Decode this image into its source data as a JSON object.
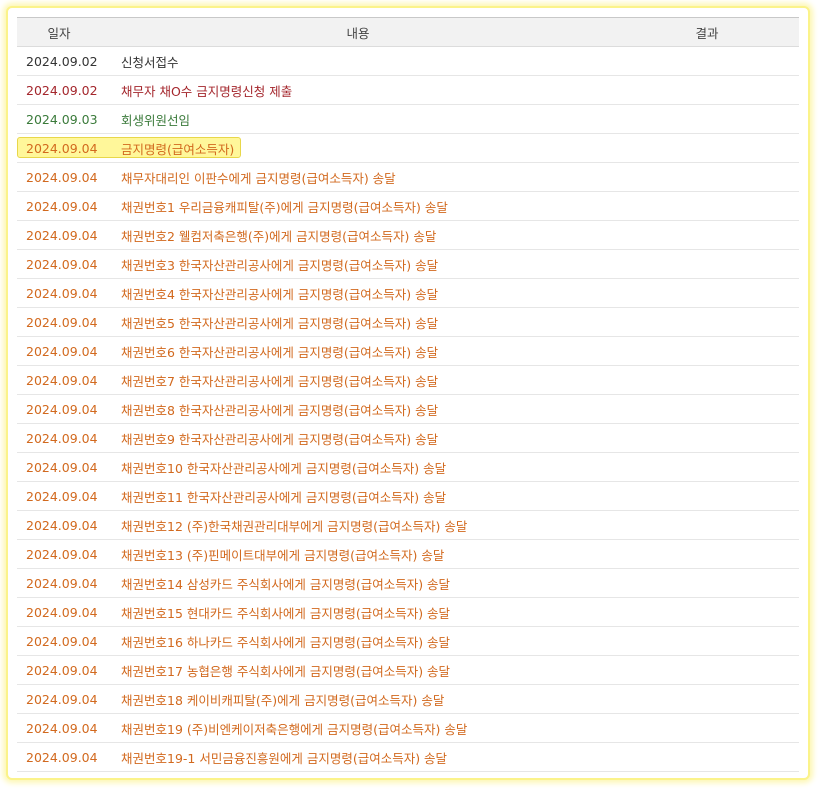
{
  "headers": {
    "date": "일자",
    "content": "내용",
    "result": "결과"
  },
  "colors": {
    "black": "#333333",
    "red": "#a4262c",
    "green": "#3a7a3a",
    "orange": "#d2691e",
    "highlight": "#fff79a"
  },
  "rows": [
    {
      "date": "2024.09.02",
      "content": "신청서접수",
      "result": "",
      "color": "black"
    },
    {
      "date": "2024.09.02",
      "content": "채무자 채O수 금지명령신청 제출",
      "result": "",
      "color": "red"
    },
    {
      "date": "2024.09.03",
      "content": "회생위원선임",
      "result": "",
      "color": "green"
    },
    {
      "date": "2024.09.04",
      "content": "금지명령(급여소득자)",
      "result": "",
      "color": "orange",
      "highlighted": true
    },
    {
      "date": "2024.09.04",
      "content": "채무자대리인 이판수에게 금지명령(급여소득자) 송달",
      "result": "",
      "color": "orange"
    },
    {
      "date": "2024.09.04",
      "content": "채권번호1 우리금융캐피탈(주)에게 금지명령(급여소득자) 송달",
      "result": "",
      "color": "orange"
    },
    {
      "date": "2024.09.04",
      "content": "채권번호2 웰컴저축은행(주)에게 금지명령(급여소득자) 송달",
      "result": "",
      "color": "orange"
    },
    {
      "date": "2024.09.04",
      "content": "채권번호3 한국자산관리공사에게 금지명령(급여소득자) 송달",
      "result": "",
      "color": "orange"
    },
    {
      "date": "2024.09.04",
      "content": "채권번호4 한국자산관리공사에게 금지명령(급여소득자) 송달",
      "result": "",
      "color": "orange"
    },
    {
      "date": "2024.09.04",
      "content": "채권번호5 한국자산관리공사에게 금지명령(급여소득자) 송달",
      "result": "",
      "color": "orange"
    },
    {
      "date": "2024.09.04",
      "content": "채권번호6 한국자산관리공사에게 금지명령(급여소득자) 송달",
      "result": "",
      "color": "orange"
    },
    {
      "date": "2024.09.04",
      "content": "채권번호7 한국자산관리공사에게 금지명령(급여소득자) 송달",
      "result": "",
      "color": "orange"
    },
    {
      "date": "2024.09.04",
      "content": "채권번호8 한국자산관리공사에게 금지명령(급여소득자) 송달",
      "result": "",
      "color": "orange"
    },
    {
      "date": "2024.09.04",
      "content": "채권번호9 한국자산관리공사에게 금지명령(급여소득자) 송달",
      "result": "",
      "color": "orange"
    },
    {
      "date": "2024.09.04",
      "content": "채권번호10 한국자산관리공사에게 금지명령(급여소득자) 송달",
      "result": "",
      "color": "orange"
    },
    {
      "date": "2024.09.04",
      "content": "채권번호11 한국자산관리공사에게 금지명령(급여소득자) 송달",
      "result": "",
      "color": "orange"
    },
    {
      "date": "2024.09.04",
      "content": "채권번호12 (주)한국채권관리대부에게 금지명령(급여소득자) 송달",
      "result": "",
      "color": "orange"
    },
    {
      "date": "2024.09.04",
      "content": "채권번호13 (주)핀메이트대부에게 금지명령(급여소득자) 송달",
      "result": "",
      "color": "orange"
    },
    {
      "date": "2024.09.04",
      "content": "채권번호14 삼성카드 주식회사에게 금지명령(급여소득자) 송달",
      "result": "",
      "color": "orange"
    },
    {
      "date": "2024.09.04",
      "content": "채권번호15 현대카드 주식회사에게 금지명령(급여소득자) 송달",
      "result": "",
      "color": "orange"
    },
    {
      "date": "2024.09.04",
      "content": "채권번호16 하나카드 주식회사에게 금지명령(급여소득자) 송달",
      "result": "",
      "color": "orange"
    },
    {
      "date": "2024.09.04",
      "content": "채권번호17 농협은행 주식회사에게 금지명령(급여소득자) 송달",
      "result": "",
      "color": "orange"
    },
    {
      "date": "2024.09.04",
      "content": "채권번호18 케이비캐피탈(주)에게 금지명령(급여소득자) 송달",
      "result": "",
      "color": "orange"
    },
    {
      "date": "2024.09.04",
      "content": "채권번호19 (주)비엔케이저축은행에게 금지명령(급여소득자) 송달",
      "result": "",
      "color": "orange"
    },
    {
      "date": "2024.09.04",
      "content": "채권번호19-1 서민금융진흥원에게 금지명령(급여소득자) 송달",
      "result": "",
      "color": "orange"
    }
  ]
}
